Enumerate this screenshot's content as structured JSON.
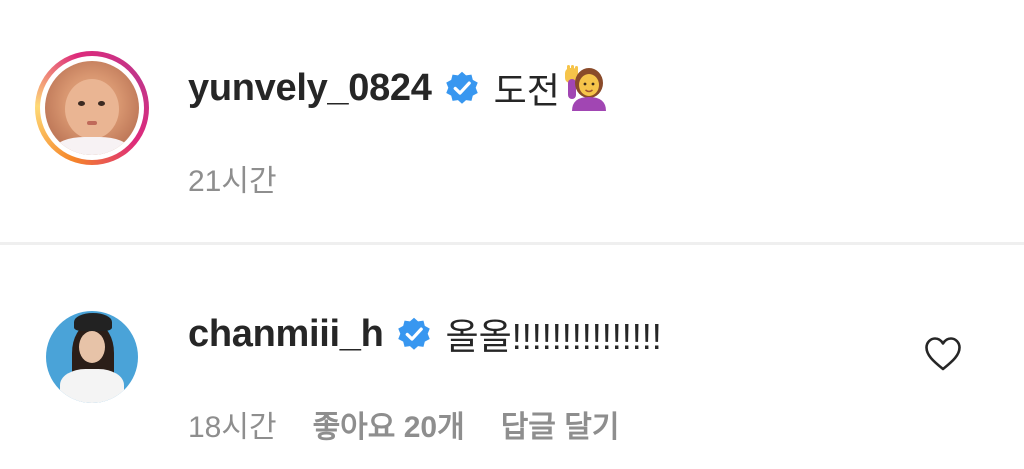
{
  "comments": [
    {
      "username": "yunvely_0824",
      "text": "도전",
      "emoji": "woman-raising-hand-emoji",
      "time": "21시간",
      "verified": true,
      "has_story_ring": true
    },
    {
      "username": "chanmiii_h",
      "text": "올올!!!!!!!!!!!!!!!",
      "time": "18시간",
      "likes": "좋아요 20개",
      "reply": "답글 달기",
      "verified": true
    }
  ],
  "colors": {
    "verified_blue": "#3897f0",
    "meta_gray": "#8e8e8e",
    "text": "#262626",
    "divider": "#efefef"
  },
  "icons": {
    "verified": "verified-badge-icon",
    "like": "heart-outline-icon"
  }
}
